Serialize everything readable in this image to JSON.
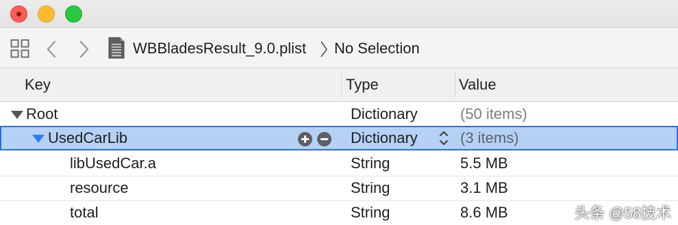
{
  "window": {
    "traffic_lights": {
      "close": "#fd5f57",
      "minimize": "#febc2e",
      "maximize": "#28c840"
    }
  },
  "jumpbar": {
    "grid_icon": "related-items-grid-icon",
    "back_icon": "chevron-left-icon",
    "forward_icon": "chevron-right-icon",
    "file_icon": "plist-file-icon",
    "file_name": "WBBladesResult_9.0.plist",
    "separator_icon": "chevron-right-icon",
    "selection": "No Selection"
  },
  "columns": {
    "key": "Key",
    "type": "Type",
    "value": "Value"
  },
  "rows": [
    {
      "key": "Root",
      "type": "Dictionary",
      "value": "(50 items)",
      "expanded": true,
      "level": 0
    },
    {
      "key": "UsedCarLib",
      "type": "Dictionary",
      "value": "(3 items)",
      "expanded": true,
      "level": 1,
      "selected": true
    },
    {
      "key": "libUsedCar.a",
      "type": "String",
      "value": "5.5 MB",
      "level": 2
    },
    {
      "key": "resource",
      "type": "String",
      "value": "3.1 MB",
      "level": 2
    },
    {
      "key": "total",
      "type": "String",
      "value": "8.6 MB",
      "level": 2
    }
  ],
  "row_controls": {
    "add_icon": "plus-circle-icon",
    "remove_icon": "minus-circle-icon",
    "type_stepper_icon": "up-down-chevron-icon"
  },
  "colors": {
    "selection_fill": "#b5d1f4",
    "selection_border": "#2a6ee6"
  },
  "watermark": "头条 @58技术"
}
